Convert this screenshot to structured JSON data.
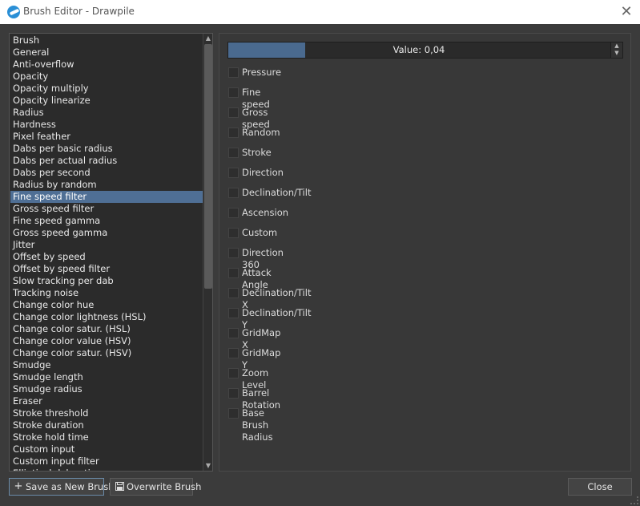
{
  "window": {
    "title": "Brush Editor - Drawpile",
    "close_icon": "close-icon"
  },
  "settings_list": {
    "items": [
      "Brush",
      "General",
      "Anti-overflow",
      "Opacity",
      "Opacity multiply",
      "Opacity linearize",
      "Radius",
      "Hardness",
      "Pixel feather",
      "Dabs per basic radius",
      "Dabs per actual radius",
      "Dabs per second",
      "Radius by random",
      "Fine speed filter",
      "Gross speed filter",
      "Fine speed gamma",
      "Gross speed gamma",
      "Jitter",
      "Offset by speed",
      "Offset by speed filter",
      "Slow tracking per dab",
      "Tracking noise",
      "Change color hue",
      "Change color lightness (HSL)",
      "Change color satur. (HSL)",
      "Change color value (HSV)",
      "Change color satur. (HSV)",
      "Smudge",
      "Smudge length",
      "Smudge radius",
      "Eraser",
      "Stroke threshold",
      "Stroke duration",
      "Stroke hold time",
      "Custom input",
      "Custom input filter",
      "Elliptical dab ratio"
    ],
    "selected": "Fine speed filter"
  },
  "value_slider": {
    "label": "Value: 0,04",
    "fill_fraction": 0.195
  },
  "inputs": [
    {
      "label": "Pressure",
      "checked": false
    },
    {
      "label": "Fine speed",
      "checked": false
    },
    {
      "label": "Gross speed",
      "checked": false
    },
    {
      "label": "Random",
      "checked": false
    },
    {
      "label": "Stroke",
      "checked": false
    },
    {
      "label": "Direction",
      "checked": false
    },
    {
      "label": "Declination/Tilt",
      "checked": false
    },
    {
      "label": "Ascension",
      "checked": false
    },
    {
      "label": "Custom",
      "checked": false
    },
    {
      "label": "Direction 360",
      "checked": false
    },
    {
      "label": "Attack Angle",
      "checked": false
    },
    {
      "label": "Declination/Tilt X",
      "checked": false
    },
    {
      "label": "Declination/Tilt Y",
      "checked": false
    },
    {
      "label": "GridMap X",
      "checked": false
    },
    {
      "label": "GridMap Y",
      "checked": false
    },
    {
      "label": "Zoom Level",
      "checked": false
    },
    {
      "label": "Barrel Rotation",
      "checked": false
    },
    {
      "label": "Base Brush Radius",
      "checked": false
    }
  ],
  "buttons": {
    "save_new": {
      "label": "Save as New Brush",
      "icon": "plus-icon"
    },
    "overwrite": {
      "label": "Overwrite Brush",
      "icon": "save-icon"
    },
    "close": {
      "label": "Close"
    }
  },
  "colors": {
    "selection": "#4f6f95",
    "slider_fill": "#4a6a8f",
    "background": "#3b3b3b"
  }
}
